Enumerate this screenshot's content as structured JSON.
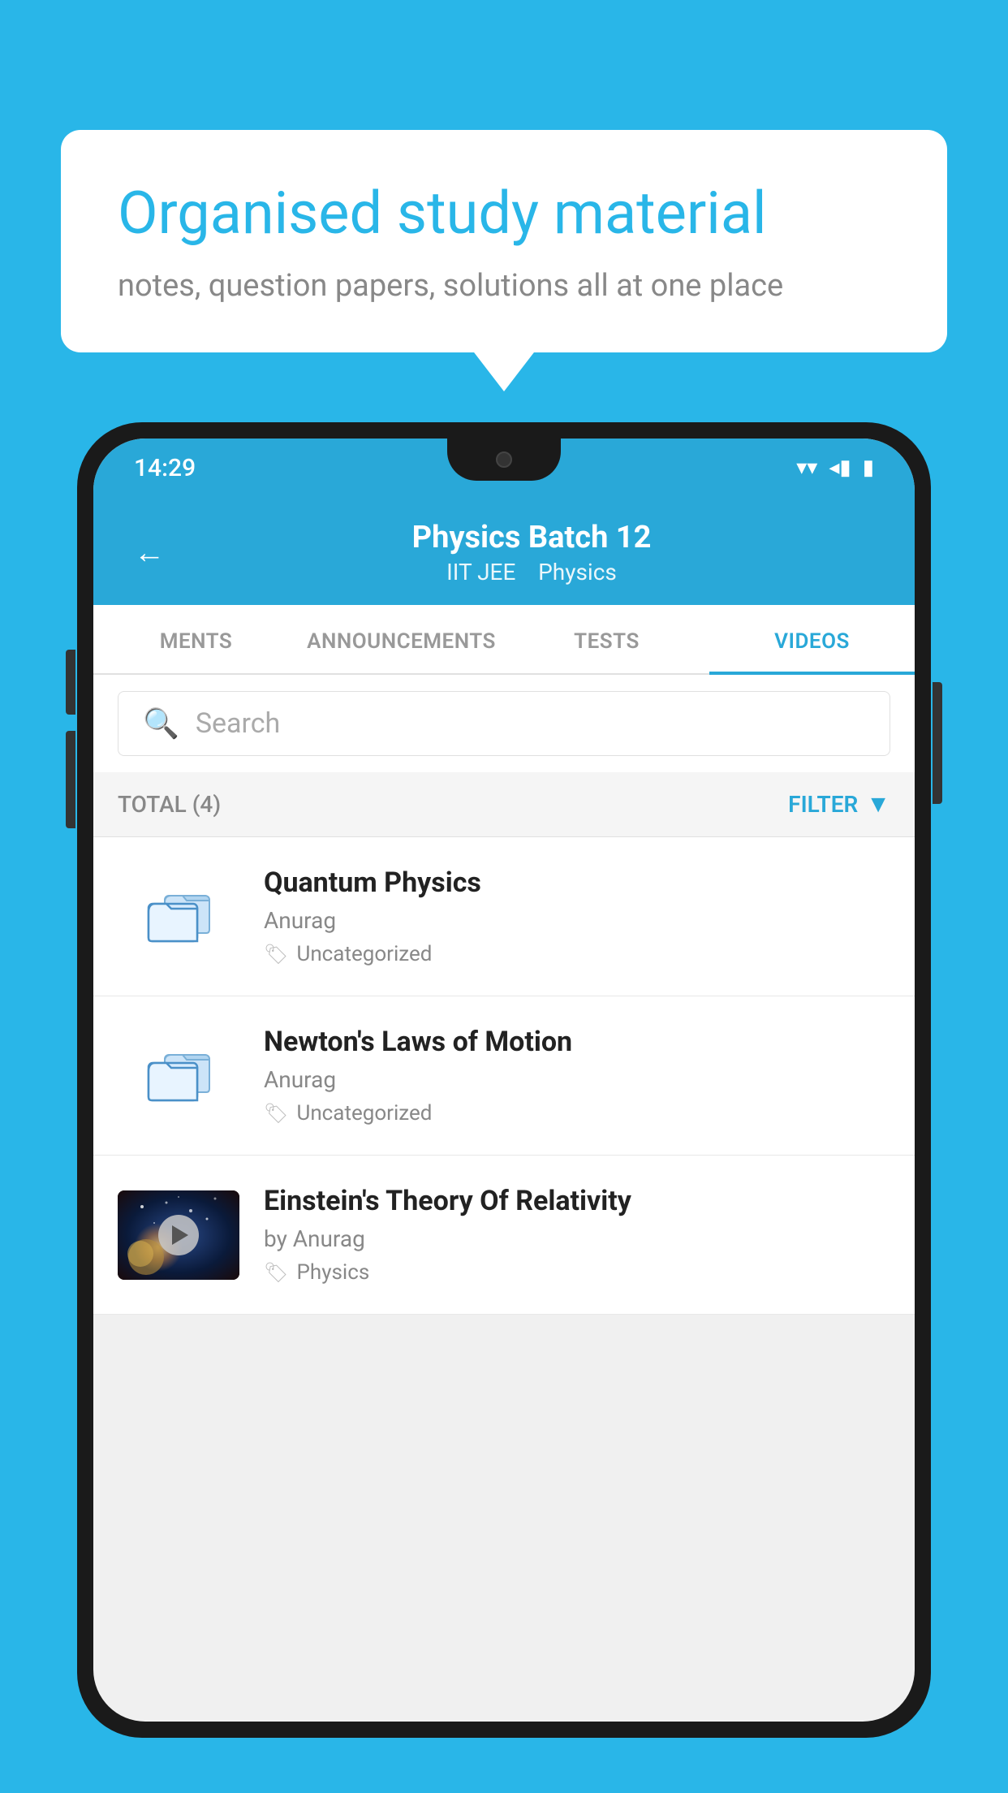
{
  "background_color": "#29B6E8",
  "speech_bubble": {
    "title": "Organised study material",
    "subtitle": "notes, question papers, solutions all at one place"
  },
  "phone": {
    "status_bar": {
      "time": "14:29",
      "wifi": "▾",
      "signal": "◂",
      "battery": "▮"
    },
    "header": {
      "back_label": "←",
      "title": "Physics Batch 12",
      "subtitle_items": [
        "IIT JEE",
        "Physics"
      ]
    },
    "tabs": [
      {
        "label": "MENTS",
        "active": false
      },
      {
        "label": "ANNOUNCEMENTS",
        "active": false
      },
      {
        "label": "TESTS",
        "active": false
      },
      {
        "label": "VIDEOS",
        "active": true
      }
    ],
    "search": {
      "placeholder": "Search"
    },
    "filter_row": {
      "total_label": "TOTAL (4)",
      "filter_label": "FILTER"
    },
    "videos": [
      {
        "id": 1,
        "title": "Quantum Physics",
        "author": "Anurag",
        "tag": "Uncategorized",
        "type": "folder",
        "thumb": null
      },
      {
        "id": 2,
        "title": "Newton's Laws of Motion",
        "author": "Anurag",
        "tag": "Uncategorized",
        "type": "folder",
        "thumb": null
      },
      {
        "id": 3,
        "title": "Einstein's Theory Of Relativity",
        "author": "by Anurag",
        "tag": "Physics",
        "type": "video",
        "thumb": "space"
      }
    ]
  }
}
